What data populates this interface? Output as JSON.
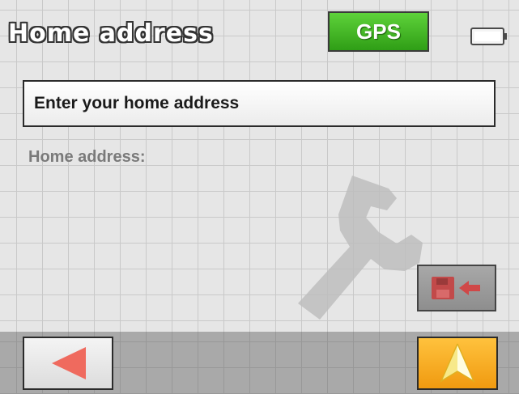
{
  "header": {
    "title": "Home address",
    "gps_label": "GPS",
    "battery_icon": "battery-icon"
  },
  "main": {
    "address_button_label": "Enter your home address",
    "address_label": "Home address:",
    "background_icon": "wrench-icon"
  },
  "actions": {
    "save_icon": "save-to-icon",
    "back_icon": "back-arrow-icon",
    "navigate_icon": "navigation-arrow-icon"
  },
  "colors": {
    "gps_green": "#3cb521",
    "navigate_orange": "#f5a623",
    "back_arrow_red": "#ef6a5e",
    "save_icon_red": "#c24a4a"
  }
}
